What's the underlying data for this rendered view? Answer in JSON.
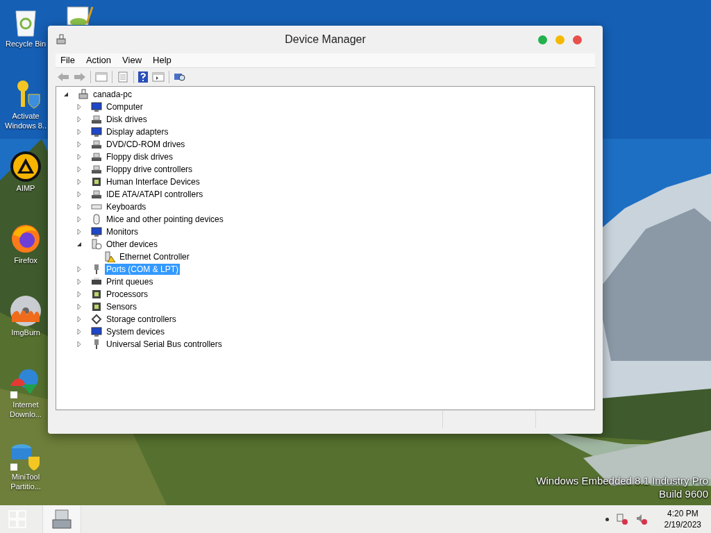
{
  "desktop_icons": [
    {
      "label": "Recycle Bin"
    },
    {
      "label": "Activate Windows 8.."
    },
    {
      "label": "AIMP"
    },
    {
      "label": "Firefox"
    },
    {
      "label": "ImgBurn"
    },
    {
      "label": "Internet Downlo..."
    },
    {
      "label": "MiniTool Partitio..."
    }
  ],
  "window": {
    "title": "Device Manager",
    "menu": [
      "File",
      "Action",
      "View",
      "Help"
    ],
    "tree": {
      "label": "canada-pc",
      "expanded": true,
      "selected": false,
      "children": [
        {
          "label": "Computer",
          "expanded": false,
          "selected": false
        },
        {
          "label": "Disk drives",
          "expanded": false,
          "selected": false
        },
        {
          "label": "Display adapters",
          "expanded": false,
          "selected": false
        },
        {
          "label": "DVD/CD-ROM drives",
          "expanded": false,
          "selected": false
        },
        {
          "label": "Floppy disk drives",
          "expanded": false,
          "selected": false
        },
        {
          "label": "Floppy drive controllers",
          "expanded": false,
          "selected": false
        },
        {
          "label": "Human Interface Devices",
          "expanded": false,
          "selected": false
        },
        {
          "label": "IDE ATA/ATAPI controllers",
          "expanded": false,
          "selected": false
        },
        {
          "label": "Keyboards",
          "expanded": false,
          "selected": false
        },
        {
          "label": "Mice and other pointing devices",
          "expanded": false,
          "selected": false
        },
        {
          "label": "Monitors",
          "expanded": false,
          "selected": false
        },
        {
          "label": "Other devices",
          "expanded": true,
          "selected": false,
          "children": [
            {
              "label": "Ethernet Controller",
              "selected": false,
              "warning": true
            }
          ]
        },
        {
          "label": "Ports (COM & LPT)",
          "expanded": false,
          "selected": true
        },
        {
          "label": "Print queues",
          "expanded": false,
          "selected": false
        },
        {
          "label": "Processors",
          "expanded": false,
          "selected": false
        },
        {
          "label": "Sensors",
          "expanded": false,
          "selected": false
        },
        {
          "label": "Storage controllers",
          "expanded": false,
          "selected": false
        },
        {
          "label": "System devices",
          "expanded": false,
          "selected": false
        },
        {
          "label": "Universal Serial Bus controllers",
          "expanded": false,
          "selected": false
        }
      ]
    }
  },
  "os_watermark": [
    "Windows Embedded 8.1 Industry Pro",
    "Build 9600"
  ],
  "taskbar": {
    "time": "4:20 PM",
    "date": "2/19/2023"
  }
}
